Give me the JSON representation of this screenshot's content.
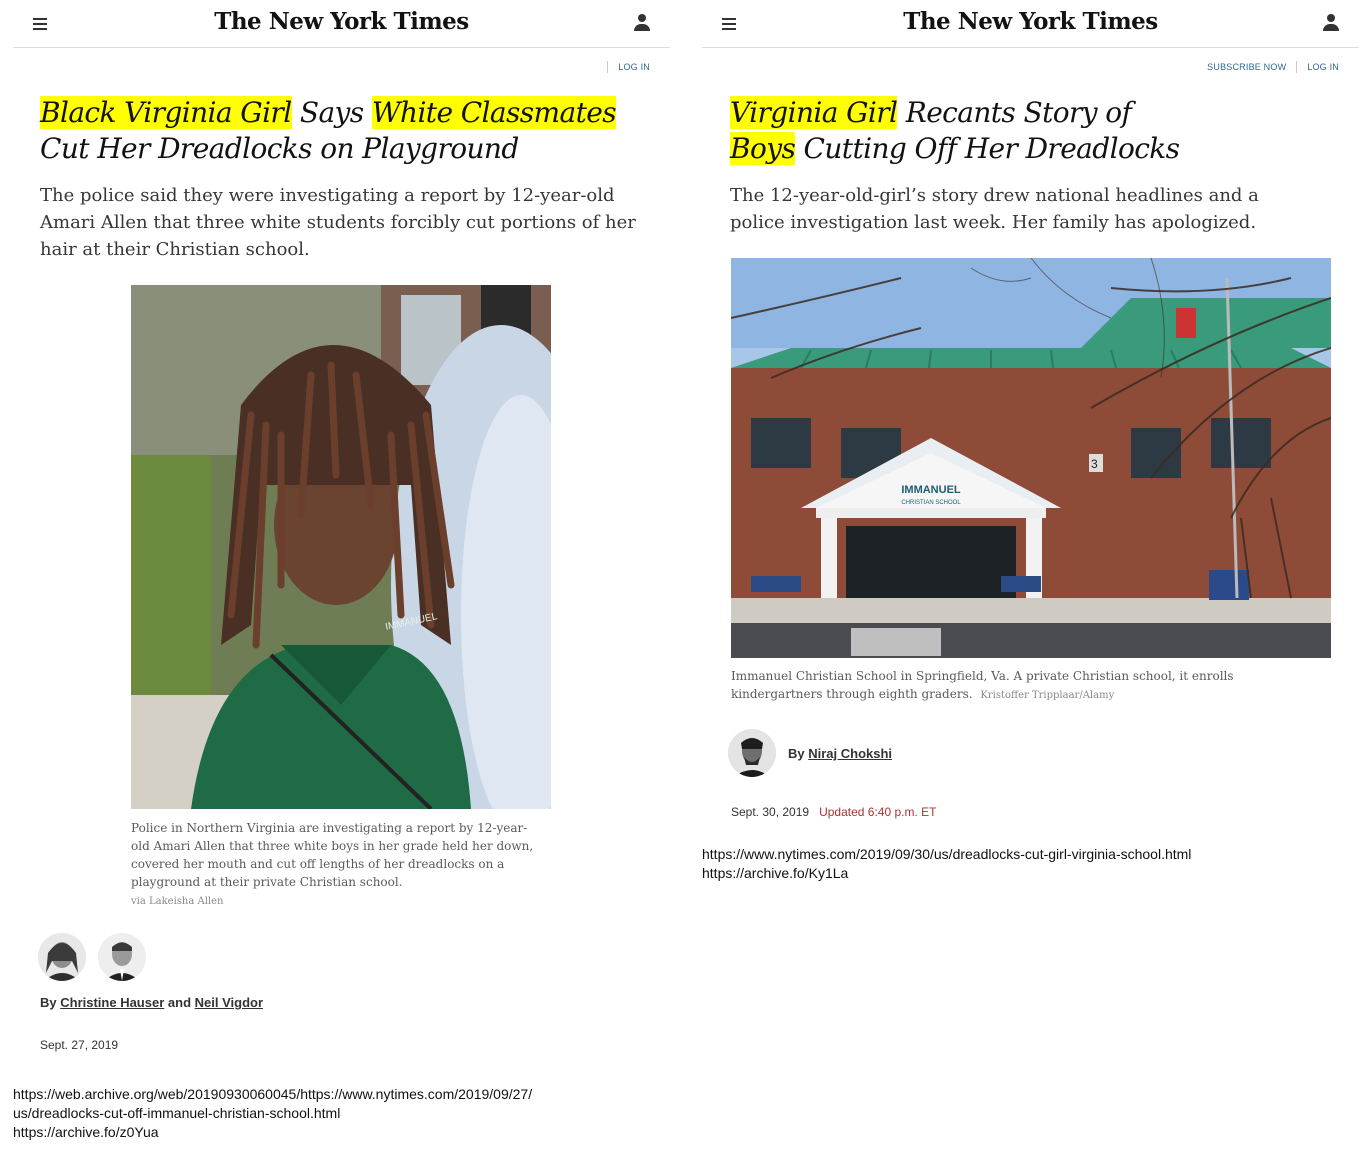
{
  "left": {
    "masthead": "The New York Times",
    "login_label": "LOG IN",
    "headline": {
      "h1": "Black Virginia Girl",
      "t1": " Says ",
      "h2": "White Classmates",
      "t2": "Cut Her Dreadlocks on Playground"
    },
    "summary": "The police said they were investigating a report by 12-year-old Amari Allen that three white students forcibly cut portions of her hair at their Christian school.",
    "caption": "Police in Northern Virginia are investigating a report by 12-year-old Amari Allen that three white boys in her grade held her down, covered her mouth and cut off lengths of her dreadlocks on a playground at their private Christian school.",
    "credit": "via Lakeisha Allen",
    "byline": {
      "prefix": "By ",
      "author1": "Christine Hauser",
      "and": " and ",
      "author2": "Neil Vigdor"
    },
    "date": "Sept. 27, 2019",
    "urls": [
      "https://web.archive.org/web/20190930060045/https://www.nytimes.com/2019/09/27/",
      "us/dreadlocks-cut-off-immanuel-christian-school.html",
      "https://archive.fo/z0Yua"
    ]
  },
  "right": {
    "masthead": "The New York Times",
    "subscribe_label": "SUBSCRIBE NOW",
    "login_label": "LOG IN",
    "headline": {
      "h1": "Virginia Girl",
      "t1": " Recants Story of",
      "h2": "Boys",
      "t2": " Cutting Off Her Dreadlocks"
    },
    "summary": "The 12-year-old-girl’s story drew national headlines and a police investigation last week. Her family has apologized.",
    "caption": "Immanuel Christian School in Springfield, Va. A private Christian school, it enrolls kindergartners through eighth graders.",
    "credit": "Kristoffer Tripplaar/Alamy",
    "school_sign": {
      "line1": "IMMANUEL",
      "line2": "CHRISTIAN SCHOOL"
    },
    "building_number": "3",
    "byline": {
      "prefix": "By ",
      "author": "Niraj Chokshi"
    },
    "date": "Sept. 30, 2019",
    "updated": "Updated 6:40 p.m. ET",
    "urls": [
      "https://www.nytimes.com/2019/09/30/us/dreadlocks-cut-girl-virginia-school.html",
      "https://archive.fo/Ky1La"
    ]
  }
}
